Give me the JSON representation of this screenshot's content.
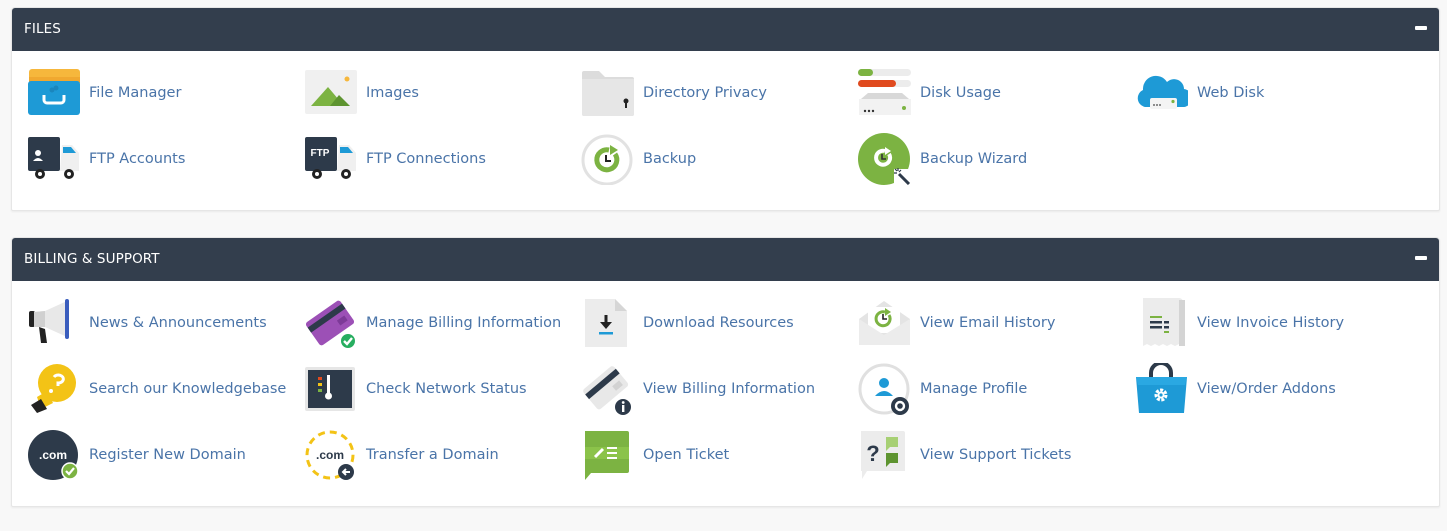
{
  "panels": {
    "files": {
      "title": "FILES",
      "items": [
        {
          "label": "File Manager",
          "icon": "file-manager-icon"
        },
        {
          "label": "Images",
          "icon": "images-icon"
        },
        {
          "label": "Directory Privacy",
          "icon": "directory-privacy-icon"
        },
        {
          "label": "Disk Usage",
          "icon": "disk-usage-icon"
        },
        {
          "label": "Web Disk",
          "icon": "web-disk-icon"
        },
        {
          "label": "FTP Accounts",
          "icon": "ftp-accounts-icon"
        },
        {
          "label": "FTP Connections",
          "icon": "ftp-connections-icon"
        },
        {
          "label": "Backup",
          "icon": "backup-icon"
        },
        {
          "label": "Backup Wizard",
          "icon": "backup-wizard-icon"
        }
      ]
    },
    "billing": {
      "title": "BILLING & SUPPORT",
      "items": [
        {
          "label": "News & Announcements",
          "icon": "megaphone-icon"
        },
        {
          "label": "Manage Billing Information",
          "icon": "credit-card-check-icon"
        },
        {
          "label": "Download Resources",
          "icon": "download-document-icon"
        },
        {
          "label": "View Email History",
          "icon": "email-history-icon"
        },
        {
          "label": "View Invoice History",
          "icon": "invoice-icon"
        },
        {
          "label": "Search our Knowledgebase",
          "icon": "lightbulb-question-icon"
        },
        {
          "label": "Check Network Status",
          "icon": "network-status-icon"
        },
        {
          "label": "View Billing Information",
          "icon": "credit-card-info-icon"
        },
        {
          "label": "Manage Profile",
          "icon": "profile-settings-icon"
        },
        {
          "label": "View/Order Addons",
          "icon": "shopping-bag-gear-icon"
        },
        {
          "label": "Register New Domain",
          "icon": "domain-register-icon"
        },
        {
          "label": "Transfer a Domain",
          "icon": "domain-transfer-icon"
        },
        {
          "label": "Open Ticket",
          "icon": "open-ticket-icon"
        },
        {
          "label": "View Support Tickets",
          "icon": "support-tickets-icon"
        }
      ]
    }
  },
  "colors": {
    "header_bg": "#333e4d",
    "link": "#4a74a8",
    "green": "#7cb342",
    "blue": "#1e9ad6"
  }
}
